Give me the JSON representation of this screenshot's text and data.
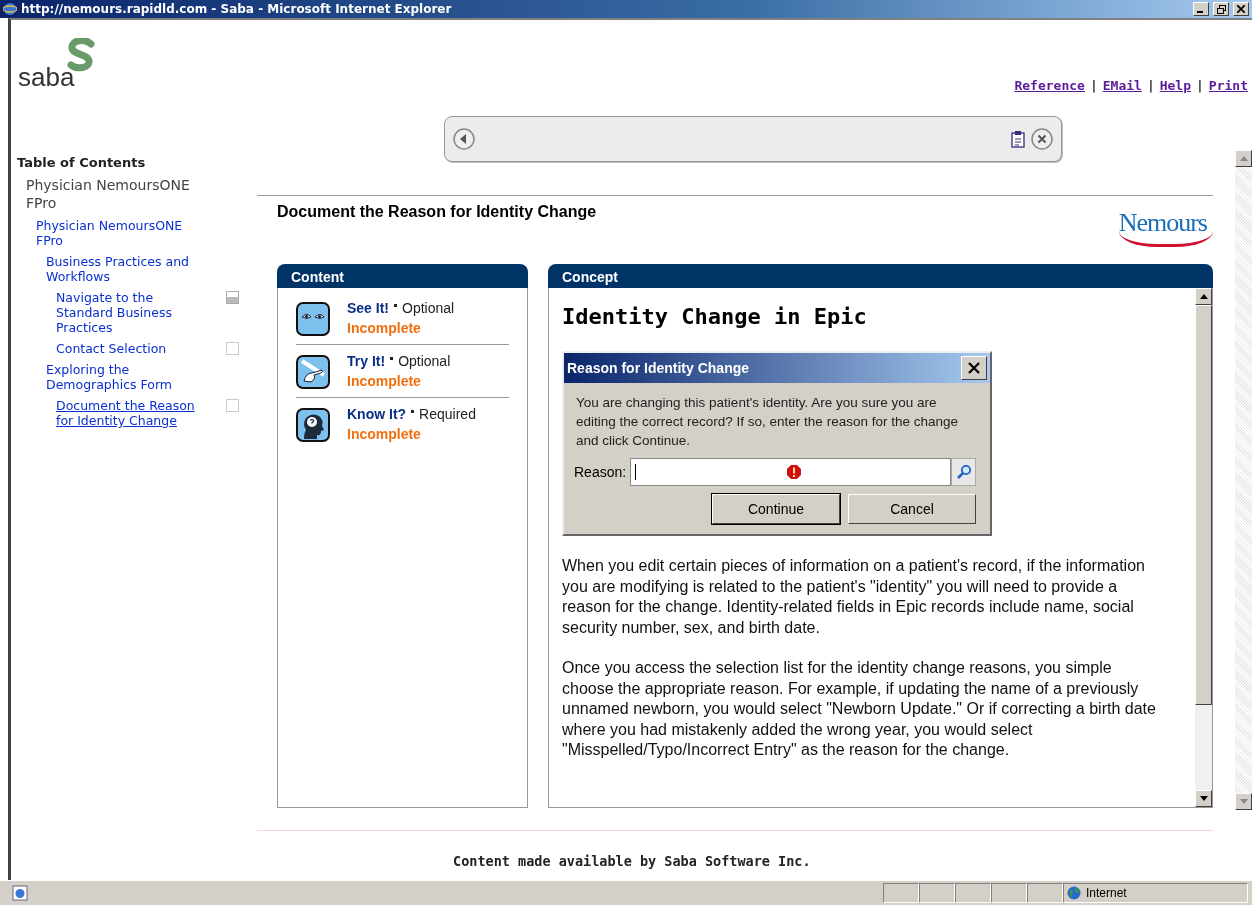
{
  "window": {
    "title": "http://nemours.rapidld.com - Saba - Microsoft Internet Explorer"
  },
  "header": {
    "logo": "saba",
    "separator": "|",
    "links": [
      "Reference",
      "EMail",
      "Help",
      "Print"
    ]
  },
  "toc": {
    "title": "Table of Contents",
    "items": [
      {
        "label": "Physician NemoursONE FPro",
        "selected": false,
        "children": [
          {
            "label": "Physician NemoursONE FPro",
            "selected": false,
            "children": [
              {
                "label": "Business Practices and Workflows",
                "selected": false,
                "children": [
                  {
                    "label": "Navigate to the Standard Business Practices",
                    "selected": false,
                    "started": true
                  },
                  {
                    "label": "Contact Selection",
                    "selected": false,
                    "started": false
                  }
                ]
              },
              {
                "label": "Exploring the Demographics Form",
                "selected": false,
                "children": [
                  {
                    "label": "Document the Reason for Identity Change",
                    "selected": true,
                    "started": false
                  }
                ]
              }
            ]
          }
        ]
      }
    ]
  },
  "page": {
    "title": "Document the Reason for Identity Change",
    "brand": "Nemours"
  },
  "content_panel": {
    "title": "Content",
    "items": [
      {
        "kind": "see",
        "label": "See It!",
        "requirement": "Optional",
        "status": "Incomplete"
      },
      {
        "kind": "try",
        "label": "Try It!",
        "requirement": "Optional",
        "status": "Incomplete"
      },
      {
        "kind": "know",
        "label": "Know It?",
        "requirement": "Required",
        "status": "Incomplete"
      }
    ]
  },
  "concept_panel": {
    "title": "Concept",
    "heading": "Identity Change in Epic",
    "dialog": {
      "title": "Reason for Identity Change",
      "message": "You are changing this patient's identity. Are you sure you are editing the correct record? If so, enter the reason for the change and click Continue.",
      "field_label": "Reason:",
      "buttons": [
        "Continue",
        "Cancel"
      ]
    },
    "paragraphs": [
      "When you edit certain pieces of information on a patient's record, if the information you are modifying is related to the patient's \"identity\" you will need to provide a reason for the change. Identity-related fields in Epic records include name, social security number, sex, and birth date.",
      "Once you access the selection list for the identity change reasons, you simple choose the appropriate reason. For example, if updating the name of a previously unnamed newborn, you would select \"Newborn Update.\" Or if correcting a birth date where you had mistakenly added the wrong year, you would select \"Misspelled/Typo/Incorrect Entry\" as the reason for the change."
    ]
  },
  "footer": "Content made available by Saba Software Inc.",
  "status_bar": {
    "zone": "Internet"
  }
}
